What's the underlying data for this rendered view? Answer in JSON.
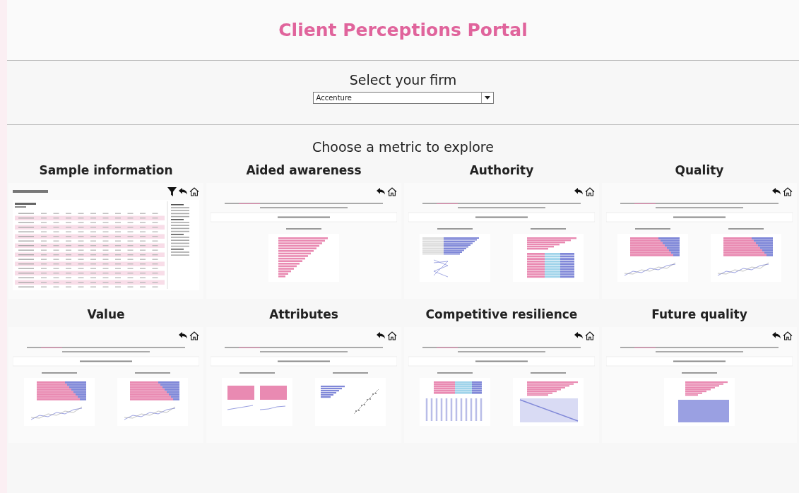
{
  "title": "Client Perceptions Portal",
  "firm_select": {
    "label": "Select your firm",
    "value": "Accenture"
  },
  "metrics_heading": "Choose a metric to explore",
  "metrics": [
    {
      "title": "Sample information",
      "preview": {
        "kind": "table",
        "panels": [
          {
            "kind": "table"
          }
        ]
      }
    },
    {
      "title": "Aided awareness",
      "preview": {
        "kind": "menu",
        "panels": [
          {
            "kind": "bars"
          }
        ]
      }
    },
    {
      "title": "Authority",
      "preview": {
        "kind": "menu",
        "panels": [
          {
            "kind": "topic"
          },
          {
            "kind": "authority"
          }
        ]
      }
    },
    {
      "title": "Quality",
      "preview": {
        "kind": "menu",
        "panels": [
          {
            "kind": "stacked"
          },
          {
            "kind": "stacked"
          }
        ]
      }
    },
    {
      "title": "Value",
      "preview": {
        "kind": "menu",
        "panels": [
          {
            "kind": "stacked"
          },
          {
            "kind": "stacked"
          }
        ]
      }
    },
    {
      "title": "Attributes",
      "preview": {
        "kind": "menu",
        "panels": [
          {
            "kind": "strength"
          },
          {
            "kind": "importance"
          }
        ]
      }
    },
    {
      "title": "Competitive resilience",
      "preview": {
        "kind": "menu",
        "panels": [
          {
            "kind": "choice"
          },
          {
            "kind": "resilience"
          }
        ]
      }
    },
    {
      "title": "Future quality",
      "preview": {
        "kind": "menu",
        "panels": [
          {
            "kind": "future"
          }
        ]
      }
    }
  ]
}
